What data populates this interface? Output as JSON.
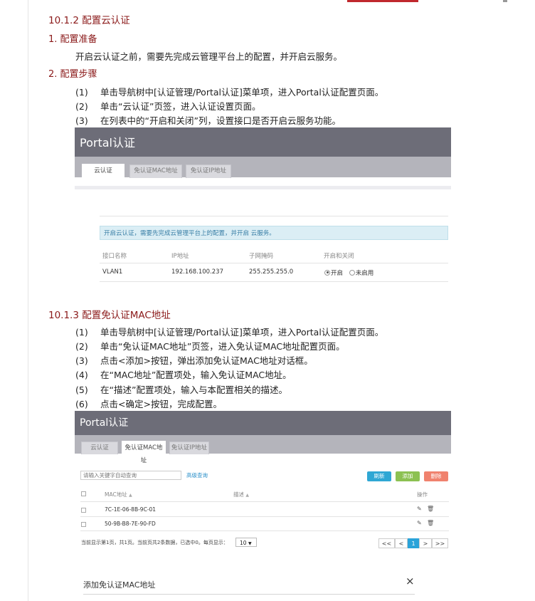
{
  "section1": {
    "heading": "10.1.2  配置云认证",
    "prep_heading": "1. 配置准备",
    "prep_text": "开启云认证之前，需要先完成云管理平台上的配置，并开启云服务。",
    "steps_heading": "2. 配置步骤",
    "steps": [
      {
        "num": "(1)",
        "text": "单击导航树中[认证管理/Portal认证]菜单项，进入Portal认证配置页面。"
      },
      {
        "num": "(2)",
        "text": "单击“云认证”页签，进入认证设置页面。"
      },
      {
        "num": "(3)",
        "text": "在列表中的“开启和关闭”列，设置接口是否开启云服务功能。"
      }
    ]
  },
  "shot1": {
    "title": "Portal认证",
    "tabs": [
      "云认证",
      "免认证MAC地址",
      "免认证IP地址"
    ],
    "notice": "开启云认证，需要先完成云管理平台上的配置，并开启 云服务。",
    "columns": [
      "接口名称",
      "IP地址",
      "子网掩码",
      "开启和关闭"
    ],
    "row": {
      "iface": "VLAN1",
      "ip": "192.168.100.237",
      "mask": "255.255.255.0",
      "on": "开启",
      "off": "未启用"
    }
  },
  "section2": {
    "heading": "10.1.3  配置免认证MAC地址",
    "steps": [
      {
        "num": "(1)",
        "text": "单击导航树中[认证管理/Portal认证]菜单项，进入Portal认证配置页面。"
      },
      {
        "num": "(2)",
        "text": "单击“免认证MAC地址”页签，进入免认证MAC地址配置页面。"
      },
      {
        "num": "(3)",
        "text": "点击<添加>按钮，弹出添加免认证MAC地址对话框。"
      },
      {
        "num": "(4)",
        "text": "在“MAC地址”配置项处，输入免认证MAC地址。"
      },
      {
        "num": "(5)",
        "text": "在“描述”配置项处，输入与本配置相关的描述。"
      },
      {
        "num": "(6)",
        "text": "点击<确定>按钮，完成配置。"
      }
    ]
  },
  "shot2": {
    "title": "Portal认证",
    "tabs": [
      "云认证",
      "免认证MAC地址",
      "免认证IP地址"
    ],
    "search_placeholder": "请输入关键字自动查询",
    "advanced": "高级查询",
    "buttons": {
      "refresh": "刷新",
      "add": "添加",
      "delete": "删除"
    },
    "columns": {
      "mac": "MAC地址",
      "desc": "描述",
      "ops": "操作"
    },
    "rows": [
      "7C-1E-06-8B-9C-01",
      "50-9B-B8-7E-90-FD"
    ],
    "footer": "当前显示第1页，共1页。当前页共2条数据，已选中0。每页显示：",
    "page_size": "10",
    "pager": [
      "<<",
      "<",
      "1",
      ">",
      ">>"
    ],
    "colors": {
      "refresh": "#2fa7d4",
      "add": "#8cc152",
      "delete": "#f0826e"
    }
  },
  "dialog": {
    "title": "添加免认证MAC地址",
    "close": "×"
  }
}
